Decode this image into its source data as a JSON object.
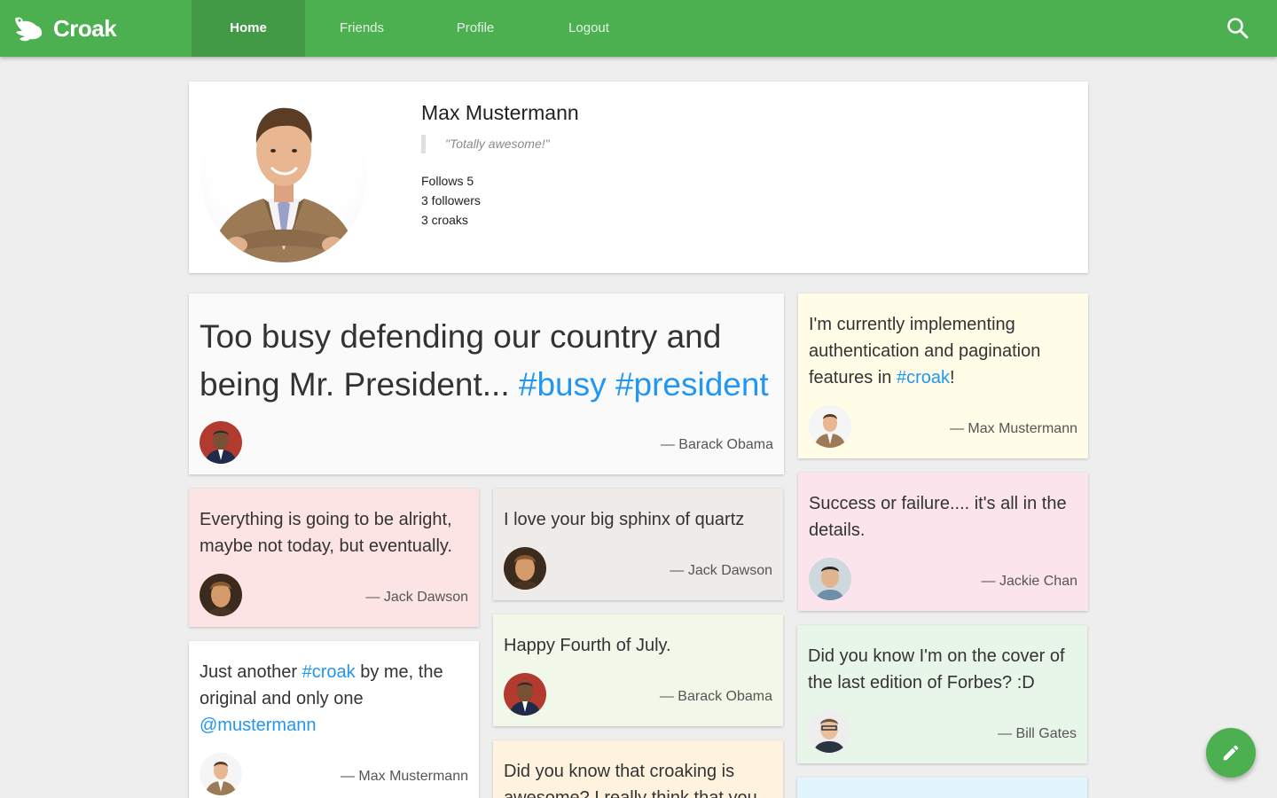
{
  "app": {
    "brand": "Croak"
  },
  "nav": {
    "items": [
      {
        "label": "Home",
        "active": true
      },
      {
        "label": "Friends",
        "active": false
      },
      {
        "label": "Profile",
        "active": false
      },
      {
        "label": "Logout",
        "active": false
      }
    ],
    "search_icon": "search-icon"
  },
  "profile": {
    "name": "Max Mustermann",
    "quote": "\"Totally awesome!\"",
    "follows": "Follows 5",
    "followers": "3 followers",
    "croaks": "3 croaks"
  },
  "croaks": [
    {
      "pre": "Too busy defending our country and being Mr. President... ",
      "tag1": "#busy",
      "mid": " ",
      "tag2": "#president",
      "author": "— Barack Obama",
      "bg": "#fafafa"
    },
    {
      "pre": "I'm currently implementing authentication and pagination features in ",
      "tag1": "#croak",
      "post": "!",
      "author": "— Max Mustermann",
      "bg": "#fffde7"
    },
    {
      "text": "Everything is going to be alright, maybe not today, but eventually.",
      "author": "— Jack Dawson",
      "bg": "#fce4e4"
    },
    {
      "text": "I love your big sphinx of quartz",
      "author": "— Jack Dawson",
      "bg": "#efebe9"
    },
    {
      "text": "Success or failure.... it's all in the details.",
      "author": "— Jackie Chan",
      "bg": "#fce4ec"
    },
    {
      "text": "Happy Fourth of July.",
      "author": "— Barack Obama",
      "bg": "#f1f8e9"
    },
    {
      "pre": "Just another ",
      "tag1": "#croak",
      "post": " by me, the original and only one",
      "mention": "@mustermann",
      "author": "— Max Mustermann",
      "bg": "#ffffff"
    },
    {
      "text": "Did you know I'm on the cover of the last edition of Forbes? :D",
      "author": "— Bill Gates",
      "bg": "#e8f5e9"
    },
    {
      "text": "Did you know that croaking is awesome? I really think that you all",
      "author": "",
      "bg": "#fff3e0"
    },
    {
      "text": "",
      "author": "",
      "bg": "#e1f5fe"
    }
  ],
  "fab": {
    "icon": "pencil-icon"
  },
  "colors": {
    "primary": "#4caf50",
    "accent": "#2196f3"
  }
}
